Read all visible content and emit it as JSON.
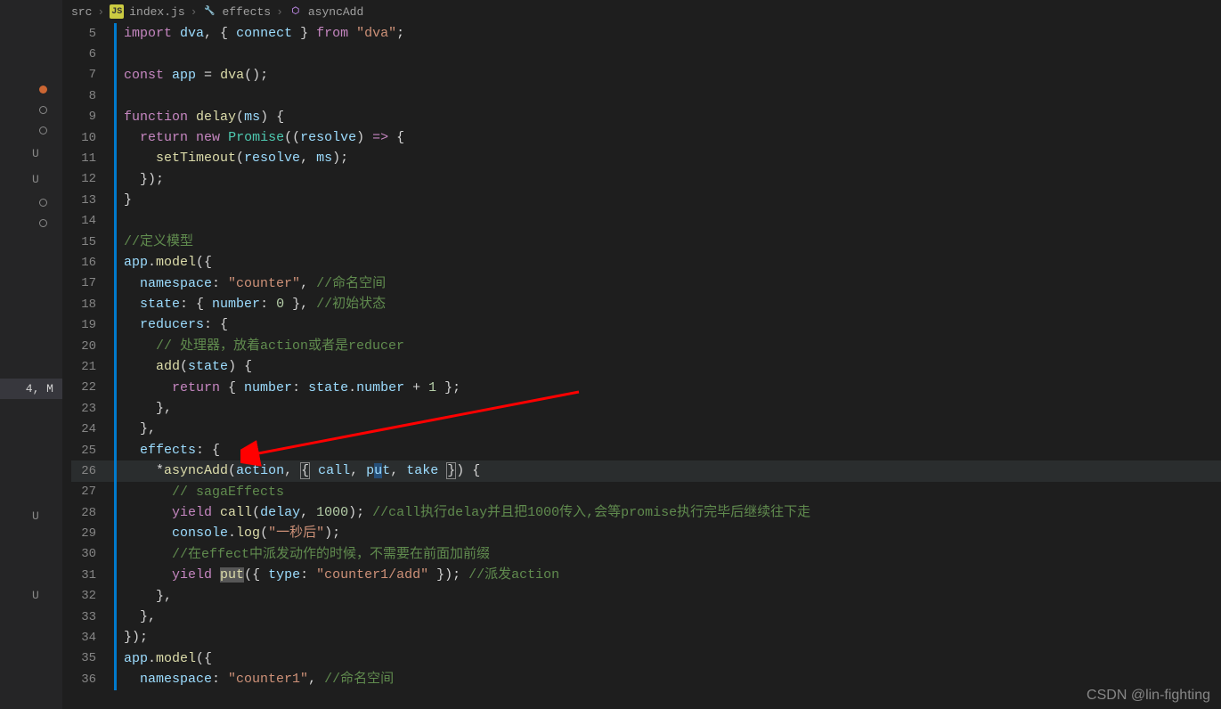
{
  "breadcrumb": {
    "p0": "src",
    "p1": "index.js",
    "p2": "effects",
    "p3": "asyncAdd"
  },
  "sidebar": {
    "active": "4, M",
    "badges": [
      "●",
      "●",
      "●",
      "U",
      "U",
      "●",
      "●",
      "",
      "",
      "",
      "",
      "",
      "",
      "U",
      "",
      "",
      "U"
    ]
  },
  "watermark": "CSDN @lin-fighting",
  "lines": {
    "5": [
      {
        "t": "import",
        "c": "kw"
      },
      {
        "t": " "
      },
      {
        "t": "dva",
        "c": "var"
      },
      {
        "t": ", { "
      },
      {
        "t": "connect",
        "c": "var"
      },
      {
        "t": " } "
      },
      {
        "t": "from",
        "c": "kw"
      },
      {
        "t": " "
      },
      {
        "t": "\"dva\"",
        "c": "str"
      },
      {
        "t": ";"
      }
    ],
    "6": [],
    "7": [
      {
        "t": "const",
        "c": "kw"
      },
      {
        "t": " "
      },
      {
        "t": "app",
        "c": "var"
      },
      {
        "t": " = "
      },
      {
        "t": "dva",
        "c": "fn"
      },
      {
        "t": "();"
      }
    ],
    "8": [],
    "9": [
      {
        "t": "function",
        "c": "kw"
      },
      {
        "t": " "
      },
      {
        "t": "delay",
        "c": "fn"
      },
      {
        "t": "("
      },
      {
        "t": "ms",
        "c": "prm"
      },
      {
        "t": ") {"
      }
    ],
    "10": [
      {
        "t": "  ",
        "ind": 1
      },
      {
        "t": "return",
        "c": "kw"
      },
      {
        "t": " "
      },
      {
        "t": "new",
        "c": "kw"
      },
      {
        "t": " "
      },
      {
        "t": "Promise",
        "c": "obj"
      },
      {
        "t": "(("
      },
      {
        "t": "resolve",
        "c": "prm"
      },
      {
        "t": ") "
      },
      {
        "t": "=>",
        "c": "kw"
      },
      {
        "t": " {"
      }
    ],
    "11": [
      {
        "t": "    ",
        "ind": 2
      },
      {
        "t": "setTimeout",
        "c": "fn"
      },
      {
        "t": "("
      },
      {
        "t": "resolve",
        "c": "var"
      },
      {
        "t": ", "
      },
      {
        "t": "ms",
        "c": "var"
      },
      {
        "t": ");"
      }
    ],
    "12": [
      {
        "t": "  ",
        "ind": 1
      },
      {
        "t": "});"
      }
    ],
    "13": [
      {
        "t": "}"
      }
    ],
    "14": [],
    "15": [
      {
        "t": "//定义模型",
        "c": "cmt"
      }
    ],
    "16": [
      {
        "t": "app",
        "c": "var"
      },
      {
        "t": "."
      },
      {
        "t": "model",
        "c": "fn"
      },
      {
        "t": "({"
      }
    ],
    "17": [
      {
        "t": "  ",
        "ind": 1
      },
      {
        "t": "namespace",
        "c": "var"
      },
      {
        "t": ": "
      },
      {
        "t": "\"counter\"",
        "c": "str"
      },
      {
        "t": ", "
      },
      {
        "t": "//命名空间",
        "c": "cmt"
      }
    ],
    "18": [
      {
        "t": "  ",
        "ind": 1
      },
      {
        "t": "state",
        "c": "var"
      },
      {
        "t": ": { "
      },
      {
        "t": "number",
        "c": "var"
      },
      {
        "t": ": "
      },
      {
        "t": "0",
        "c": "num"
      },
      {
        "t": " }, "
      },
      {
        "t": "//初始状态",
        "c": "cmt"
      }
    ],
    "19": [
      {
        "t": "  ",
        "ind": 1
      },
      {
        "t": "reducers",
        "c": "var"
      },
      {
        "t": ": {"
      }
    ],
    "20": [
      {
        "t": "    ",
        "ind": 2
      },
      {
        "t": "// 处理器，放着action或者是reducer",
        "c": "cmt"
      }
    ],
    "21": [
      {
        "t": "    ",
        "ind": 2
      },
      {
        "t": "add",
        "c": "fn"
      },
      {
        "t": "("
      },
      {
        "t": "state",
        "c": "prm"
      },
      {
        "t": ") {"
      }
    ],
    "22": [
      {
        "t": "      ",
        "ind": 3
      },
      {
        "t": "return",
        "c": "kw"
      },
      {
        "t": " { "
      },
      {
        "t": "number",
        "c": "var"
      },
      {
        "t": ": "
      },
      {
        "t": "state",
        "c": "var"
      },
      {
        "t": "."
      },
      {
        "t": "number",
        "c": "var"
      },
      {
        "t": " + "
      },
      {
        "t": "1",
        "c": "num"
      },
      {
        "t": " };"
      }
    ],
    "23": [
      {
        "t": "    ",
        "ind": 2
      },
      {
        "t": "},"
      }
    ],
    "24": [
      {
        "t": "  ",
        "ind": 1
      },
      {
        "t": "},"
      }
    ],
    "25": [
      {
        "t": "  ",
        "ind": 1
      },
      {
        "t": "effects",
        "c": "var"
      },
      {
        "t": ": {"
      }
    ],
    "26": [
      {
        "t": "    ",
        "ind": 2
      },
      {
        "t": "*"
      },
      {
        "t": "asyncAdd",
        "c": "fn"
      },
      {
        "t": "("
      },
      {
        "t": "action",
        "c": "prm"
      },
      {
        "t": ", "
      },
      {
        "t": "{",
        "c": "box"
      },
      {
        "t": " "
      },
      {
        "t": "call",
        "c": "var"
      },
      {
        "t": ", "
      },
      {
        "t": "p",
        "c": "var"
      },
      {
        "t": "u",
        "c": "var cursor-bg"
      },
      {
        "t": "t",
        "c": "var"
      },
      {
        "t": ", "
      },
      {
        "t": "take",
        "c": "var"
      },
      {
        "t": " "
      },
      {
        "t": "}",
        "c": "box"
      },
      {
        "t": ") {"
      }
    ],
    "27": [
      {
        "t": "      ",
        "ind": 3
      },
      {
        "t": "// sagaEffects",
        "c": "cmt"
      }
    ],
    "28": [
      {
        "t": "      ",
        "ind": 3
      },
      {
        "t": "yield",
        "c": "kw"
      },
      {
        "t": " "
      },
      {
        "t": "call",
        "c": "fn"
      },
      {
        "t": "("
      },
      {
        "t": "delay",
        "c": "var"
      },
      {
        "t": ", "
      },
      {
        "t": "1000",
        "c": "num"
      },
      {
        "t": "); "
      },
      {
        "t": "//call执行delay并且把1000传入,会等promise执行完毕后继续往下走",
        "c": "cmt"
      }
    ],
    "29": [
      {
        "t": "      ",
        "ind": 3
      },
      {
        "t": "console",
        "c": "var"
      },
      {
        "t": "."
      },
      {
        "t": "log",
        "c": "fn"
      },
      {
        "t": "("
      },
      {
        "t": "\"一秒后\"",
        "c": "str"
      },
      {
        "t": ");"
      }
    ],
    "30": [
      {
        "t": "      ",
        "ind": 3
      },
      {
        "t": "//在effect中派发动作的时候，不需要在前面加前缀",
        "c": "cmt"
      }
    ],
    "31": [
      {
        "t": "      ",
        "ind": 3
      },
      {
        "t": "yield",
        "c": "kw"
      },
      {
        "t": " "
      },
      {
        "t": "put",
        "c": "fn",
        "hl": true
      },
      {
        "t": "({ "
      },
      {
        "t": "type",
        "c": "var"
      },
      {
        "t": ": "
      },
      {
        "t": "\"counter1/add\"",
        "c": "str"
      },
      {
        "t": " }); "
      },
      {
        "t": "//派发action",
        "c": "cmt"
      }
    ],
    "32": [
      {
        "t": "    ",
        "ind": 2
      },
      {
        "t": "},"
      }
    ],
    "33": [
      {
        "t": "  ",
        "ind": 1
      },
      {
        "t": "},"
      }
    ],
    "34": [
      {
        "t": "});"
      }
    ],
    "35": [
      {
        "t": "app",
        "c": "var"
      },
      {
        "t": "."
      },
      {
        "t": "model",
        "c": "fn"
      },
      {
        "t": "({"
      }
    ],
    "36": [
      {
        "t": "  ",
        "ind": 1
      },
      {
        "t": "namespace",
        "c": "var"
      },
      {
        "t": ": "
      },
      {
        "t": "\"counter1\"",
        "c": "str"
      },
      {
        "t": ", "
      },
      {
        "t": "//命名空间",
        "c": "cmt"
      }
    ]
  }
}
